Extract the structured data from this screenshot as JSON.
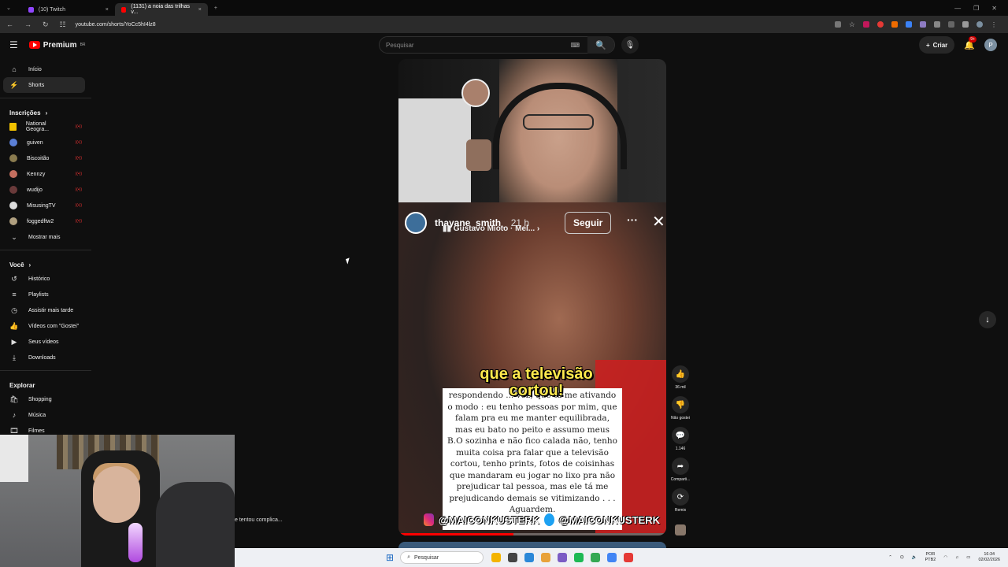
{
  "browser": {
    "tabs": [
      {
        "title": "(10) Twitch",
        "close": "×",
        "color": "#9146ff"
      },
      {
        "title": "(1131) a noia das trilhas v...",
        "close": "×",
        "color": "#ff0000"
      }
    ],
    "new_tab": "+",
    "url": "youtube.com/shorts/YoCc5hI4lz8",
    "nav": {
      "back": "←",
      "forward": "→",
      "reload": "↻",
      "site_info": "☷"
    }
  },
  "header": {
    "menu": "☰",
    "logo_text": "Premium",
    "logo_sup": "BR",
    "search_placeholder": "Pesquisar",
    "keyboard": "⌨",
    "search_icon": "🔍",
    "mic_icon": "🎙",
    "create_label": "Criar",
    "notif_badge": "9+",
    "avatar_letter": "P"
  },
  "sidebar": {
    "main": [
      {
        "icon": "⌂",
        "label": "Início"
      },
      {
        "icon": "⚡",
        "label": "Shorts",
        "active": true
      }
    ],
    "subs_title": "Inscrições",
    "subs": [
      {
        "label": "National Geogra...",
        "color": "#f2c200"
      },
      {
        "label": "guiven",
        "color": "#5a7fd6"
      },
      {
        "label": "Biscoitão",
        "color": "#8a7b4f"
      },
      {
        "label": "Kennzy",
        "color": "#c56f5f"
      },
      {
        "label": "wudijo",
        "color": "#6a3a3a"
      },
      {
        "label": "MisusingTV",
        "color": "#dddddd"
      },
      {
        "label": "foggedftw2",
        "color": "#b0a080"
      }
    ],
    "live_mark": "((•))",
    "show_more": "Mostrar mais",
    "you_title": "Você",
    "you": [
      {
        "icon": "↺",
        "label": "Histórico"
      },
      {
        "icon": "≡",
        "label": "Playlists"
      },
      {
        "icon": "◷",
        "label": "Assistir mais tarde"
      },
      {
        "icon": "👍",
        "label": "Vídeos com \"Gostei\""
      },
      {
        "icon": "▶",
        "label": "Seus vídeos"
      },
      {
        "icon": "⤓",
        "label": "Downloads"
      }
    ],
    "explore_title": "Explorar",
    "explore": [
      {
        "icon": "🛍",
        "label": "Shopping"
      },
      {
        "icon": "♪",
        "label": "Música"
      },
      {
        "icon": "🎞",
        "label": "Filmes"
      }
    ]
  },
  "short": {
    "story_user": "thayane_smith_",
    "story_time": "21 h",
    "story_music": "Gustavo Mioto · Mel...  ›",
    "follow_label": "Seguir",
    "more": "···",
    "close": "✕",
    "caption": "que a televisão cortou!",
    "note_text": "respondendo ... voz, que tá me ativando o modo : eu tenho pessoas por mim, que falam pra eu me manter equilibrada, mas eu bato no peito e assumo meus B.O sozinha e não fico calada não, tenho muita coisa pra falar que a televisão cortou, tenho prints, fotos de coisinhas que mandaram eu jogar no lixo pra não prejudicar tal pessoa, mas ele tá me prejudicando demais se vitimizando . . . Aguardem.",
    "watermark_ig": "@MAICONKUSTERK",
    "watermark_tw": "@MAICONKUSTERK",
    "progress": 0.43
  },
  "actions": [
    {
      "icon": "👍",
      "label": "36 mil"
    },
    {
      "icon": "👎",
      "label": "Não gostei"
    },
    {
      "icon": "💬",
      "label": "1.146"
    },
    {
      "icon": "➦",
      "label": "Comparti..."
    },
    {
      "icon": "⟳",
      "label": "Remix"
    }
  ],
  "down_arrow": "↓",
  "toast": "e tentou complica...",
  "taskbar": {
    "start": "⊞",
    "search_label": "Pesquisar",
    "search_icon": "⌕",
    "lang_top": "POR",
    "lang_bottom": "PTB2",
    "time": "16:34",
    "date": "02/02/2026",
    "apps": [
      "#f4b400",
      "#444444",
      "#2b88d8",
      "#e8a23a",
      "#7b5cc4",
      "#1db954",
      "#34a853",
      "#4285f4",
      "#e53935"
    ]
  }
}
